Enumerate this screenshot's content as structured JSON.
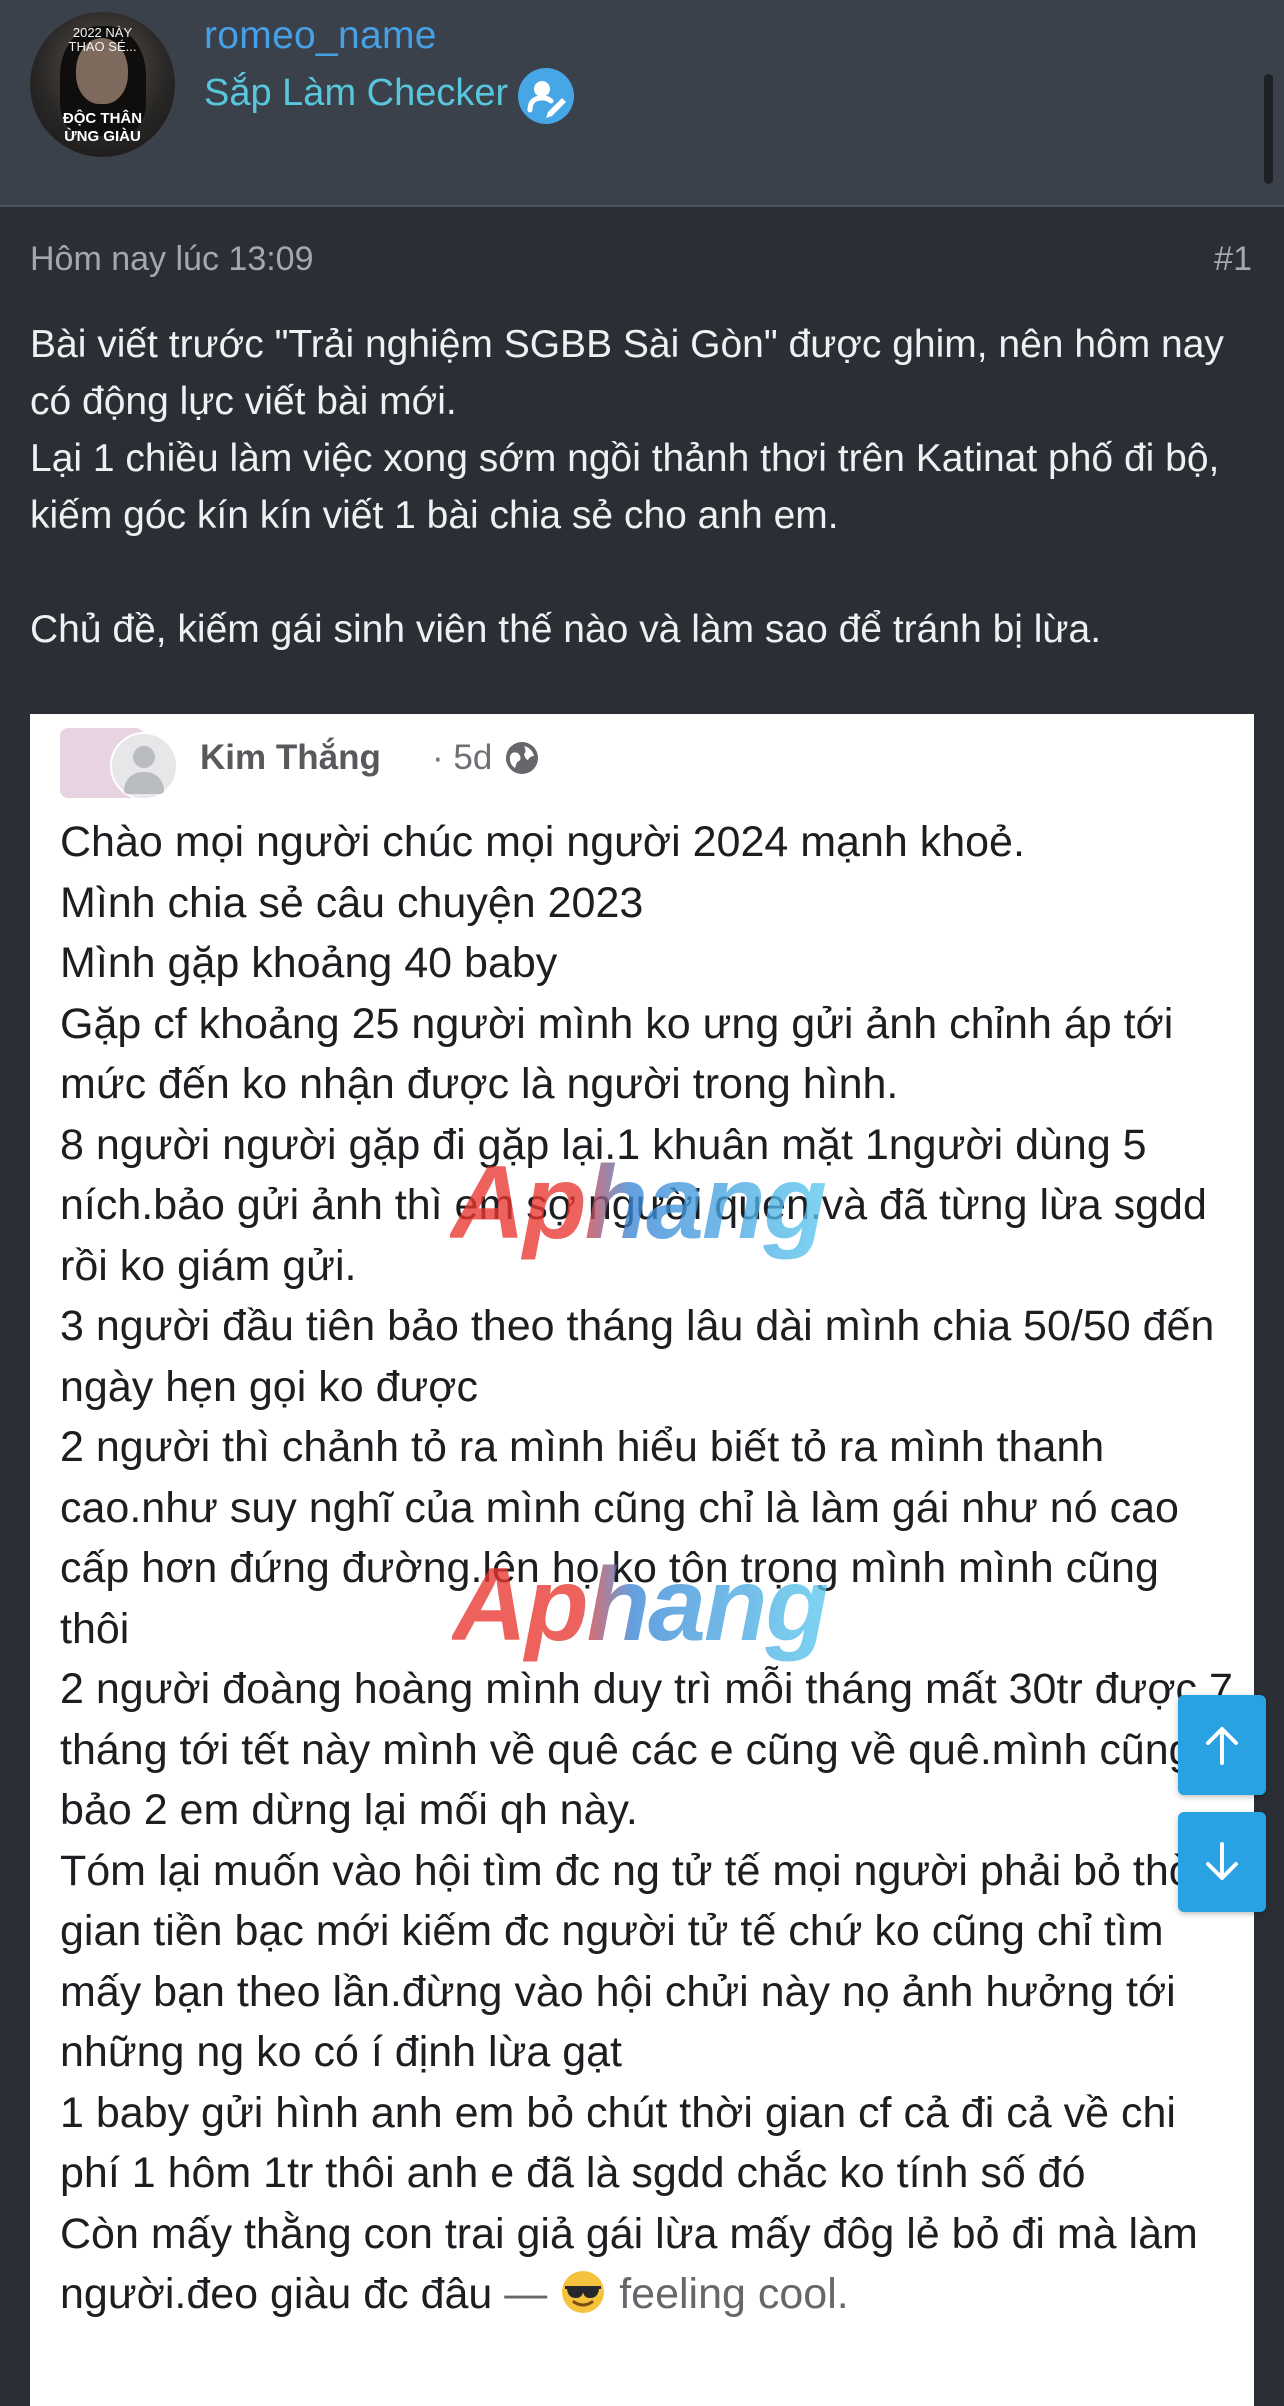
{
  "header": {
    "avatar_caption_top": "2022 NÀY\nTHAO SÉ...",
    "avatar_caption_bottom": "ĐỘC THÂN\nỪNG GIÀU",
    "username": "romeo_name",
    "user_title": "Sắp Làm Checker",
    "badge_icon": "edit-badge-icon"
  },
  "post": {
    "timestamp": "Hôm nay lúc 13:09",
    "post_number": "#1",
    "body": "Bài viết trước \"Trải nghiệm SGBB Sài Gòn\" được ghim, nên hôm nay có động lực viết bài mới.\nLại 1 chiều làm việc xong sớm ngồi thảnh thơi trên Katinat phố đi bộ, kiếm góc kín kín viết 1 bài chia sẻ cho anh em.\n\nChủ đề, kiếm gái sinh viên thế nào và làm sao để tránh bị lừa."
  },
  "embedded_screenshot": {
    "author": "Kim Thắng",
    "meta": "· 5d ·",
    "privacy_icon": "globe-icon",
    "text": "Chào mọi người chúc mọi người 2024 mạnh khoẻ.\nMình chia sẻ câu chuyện 2023\nMình gặp khoảng 40 baby\nGặp cf khoảng 25 người mình ko ưng gửi ảnh chỉnh áp tới mức đến ko nhận được là người trong hình.\n8 người người gặp đi gặp lại.1 khuân mặt 1người dùng 5 ních.bảo gửi ảnh thì em sợ người quen.và đã từng lừa sgdd rồi ko giám gửi.\n3 người đầu tiên bảo theo tháng lâu dài mình chia 50/50 đến ngày hẹn gọi ko được\n2 người thì chảnh tỏ ra mình hiểu biết tỏ ra mình thanh cao.như suy nghĩ của mình cũng chỉ là làm gái như nó cao cấp hơn đứng đường.lên họ ko tôn trọng mình mình cũng thôi\n2 người đoàng hoàng mình duy trì mỗi tháng mất 30tr được 7 tháng tới tết này mình về quê các e cũng về quê.mình cũng bảo 2 em dừng lại mối qh này.\nTóm lại muốn vào hội tìm đc ng tử tế mọi người phải bỏ thời gian tiền bạc mới kiếm đc người tử tế chứ ko cũng chỉ tìm mấy bạn theo lần.đừng vào hội chửi này nọ ảnh hưởng tới những ng ko có í định lừa gạt\n1 baby gửi hình anh em bỏ chút thời gian cf cả đi cả về chi phí 1 hôm 1tr thôi anh e đã là sgdd chắc ko tính số đó\nCòn mấy thằng con trai giả gái lừa mấy đôg lẻ bỏ đi mà làm người.đeo giàu đc đâu",
    "feeling_dash": " — ",
    "feeling_text": " feeling cool.",
    "feeling_emoji": "sunglasses-emoji-icon",
    "watermark": "Aphang"
  },
  "navigation": {
    "scroll_up_icon": "arrow-up-icon",
    "scroll_down_icon": "arrow-down-icon"
  },
  "colors": {
    "background": "#2b2f35",
    "header_bg": "#3b414a",
    "username": "#46a0e6",
    "user_title": "#58c7dd",
    "nav_button": "#28a2e3"
  }
}
